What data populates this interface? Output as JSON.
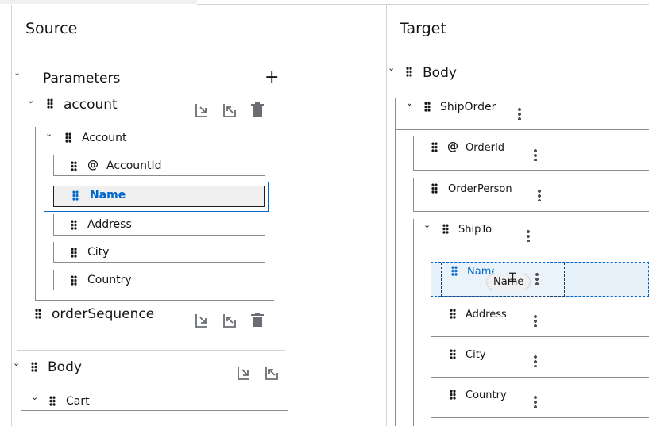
{
  "source": {
    "title": "Source",
    "parameters": {
      "label": "Parameters",
      "add_icon": "plus-icon"
    },
    "account": {
      "label": "account",
      "child": "Account",
      "fields": [
        {
          "label": "AccountId",
          "attr": "@"
        },
        {
          "label": "Name",
          "selected": true
        },
        {
          "label": "Address"
        },
        {
          "label": "City"
        },
        {
          "label": "Country"
        }
      ]
    },
    "order_sequence": {
      "label": "orderSequence"
    },
    "body": {
      "label": "Body",
      "child": "Cart"
    },
    "action_icons": [
      "import-icon",
      "export-icon",
      "trash-icon"
    ]
  },
  "target": {
    "title": "Target",
    "body": "Body",
    "ship_order": "ShipOrder",
    "order_id": {
      "label": "OrderId",
      "attr": "@"
    },
    "order_person": "OrderPerson",
    "ship_to": "ShipTo",
    "ship_to_fields": [
      {
        "label": "Name",
        "drop_target": true
      },
      {
        "label": "Address"
      },
      {
        "label": "City"
      },
      {
        "label": "Country"
      }
    ],
    "drag_preview_label": "Name"
  },
  "colors": {
    "selection": "#0066cc",
    "drop_bg": "#e7f1fa",
    "border": "#d2d2d2",
    "tree_line": "#8a8d90"
  }
}
